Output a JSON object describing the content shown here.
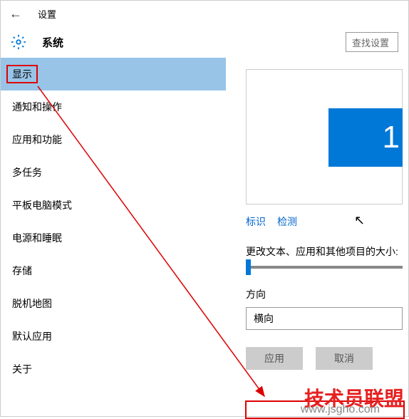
{
  "header": {
    "back_glyph": "←",
    "breadcrumb": "设置"
  },
  "title": {
    "page": "系统",
    "search_placeholder": "查找设置"
  },
  "sidebar": {
    "items": [
      {
        "label": "显示",
        "selected": true,
        "highlighted": true
      },
      {
        "label": "通知和操作"
      },
      {
        "label": "应用和功能"
      },
      {
        "label": "多任务"
      },
      {
        "label": "平板电脑模式"
      },
      {
        "label": "电源和睡眠"
      },
      {
        "label": "存储"
      },
      {
        "label": "脱机地图"
      },
      {
        "label": "默认应用"
      },
      {
        "label": "关于"
      }
    ]
  },
  "content": {
    "monitor_number": "1",
    "link_identify": "标识",
    "link_detect": "检测",
    "scale_label": "更改文本、应用和其他项目的大小:",
    "orientation_label": "方向",
    "orientation_value": "横向",
    "apply_btn": "应用",
    "cancel_btn": "取消"
  },
  "watermark": {
    "text_main": "技术员联盟",
    "url": "www.jsgho.com"
  }
}
